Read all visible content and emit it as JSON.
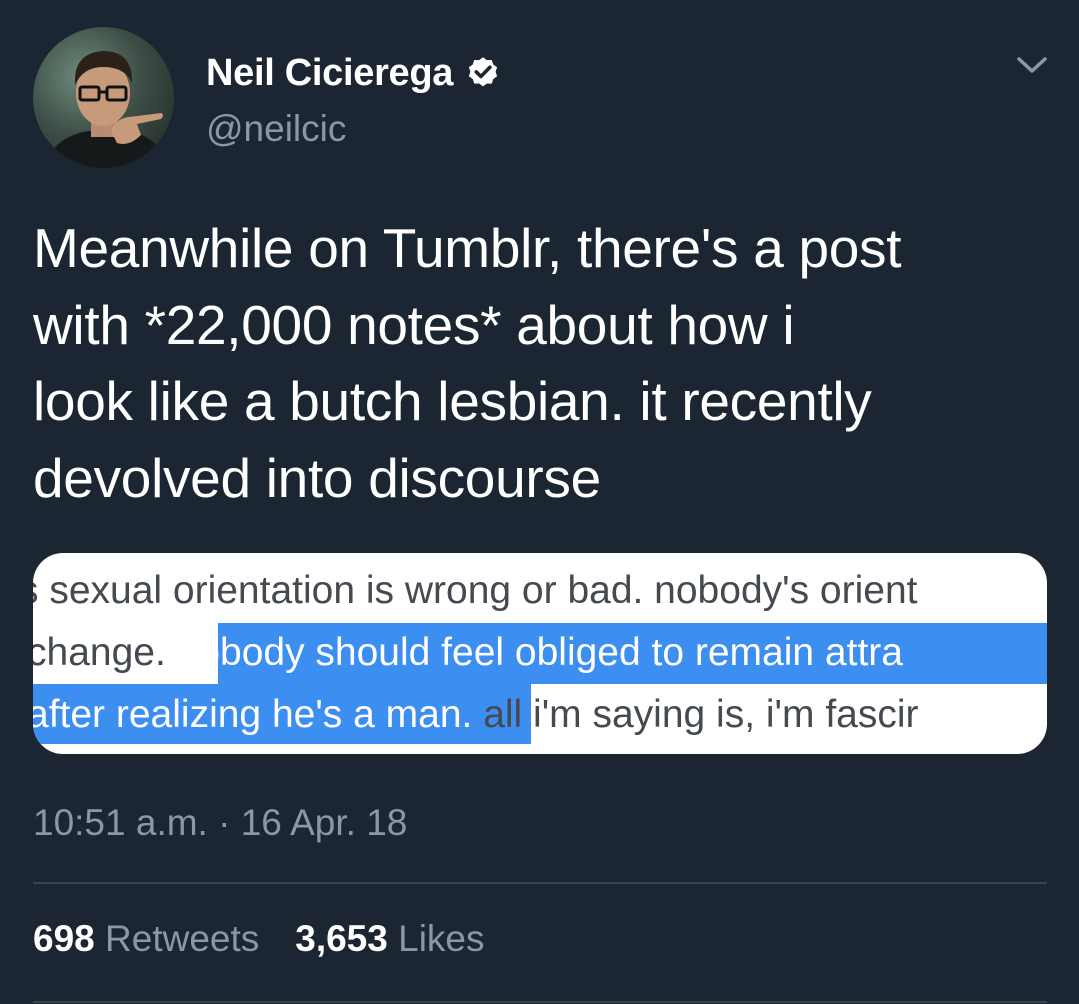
{
  "tweet": {
    "author": {
      "display_name": "Neil Cicierega",
      "handle": "@neilcic",
      "verified": true
    },
    "text_lines": [
      "Meanwhile on Tumblr, there's a post",
      "with *22,000 notes* about how i",
      "look like a butch lesbian. it recently",
      "devolved into discourse"
    ],
    "media": {
      "line1": "s sexual orientation is wrong or bad. nobody's orient",
      "line2_plain": "change.",
      "line2_highlight": "nobody should feel obliged to remain attra",
      "line3_highlight": "after realizing he's a man.",
      "line3_plain": "all i'm saying is, i'm fascir"
    },
    "timestamp": "10:51 a.m. · 16 Apr. 18",
    "stats": {
      "retweets_count": "698",
      "retweets_label": "Retweets",
      "likes_count": "3,653",
      "likes_label": "Likes"
    }
  },
  "colors": {
    "background": "#1c2532",
    "secondary_text": "#8899a6",
    "highlight": "#3d8ef1",
    "divider": "#38444d"
  },
  "icons": {
    "verified": "verified-badge-icon",
    "menu": "chevron-down-icon"
  }
}
